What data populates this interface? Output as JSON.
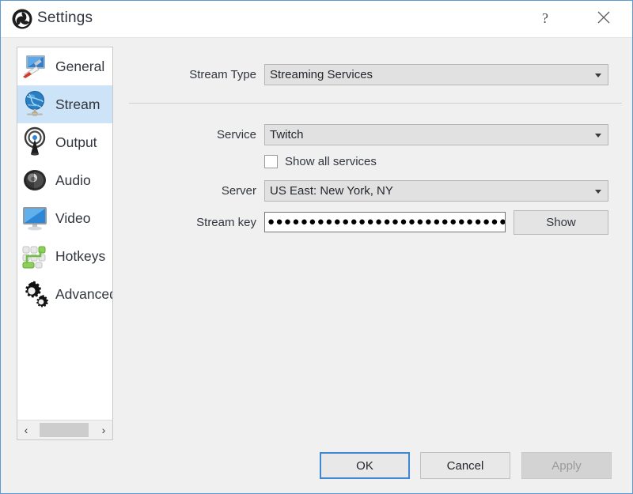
{
  "window": {
    "title": "Settings",
    "logo_icon": "obs-logo-icon",
    "help_label": "?",
    "close_label": "✕",
    "accent_color": "#5b9bd5",
    "selection_color": "#cde3f7"
  },
  "sidebar": {
    "items": [
      {
        "label": "General",
        "icon": "general-monitor-screwdriver-icon",
        "selected": false
      },
      {
        "label": "Stream",
        "icon": "stream-globe-icon",
        "selected": true
      },
      {
        "label": "Output",
        "icon": "output-broadcast-icon",
        "selected": false
      },
      {
        "label": "Audio",
        "icon": "audio-speaker-icon",
        "selected": false
      },
      {
        "label": "Video",
        "icon": "video-monitor-icon",
        "selected": false
      },
      {
        "label": "Hotkeys",
        "icon": "hotkeys-keyboard-icon",
        "selected": false
      },
      {
        "label": "Advanced",
        "icon": "advanced-gears-icon",
        "selected": false
      }
    ],
    "scrollbar": {
      "left_arrow": "‹",
      "right_arrow": "›"
    }
  },
  "main": {
    "stream_type": {
      "label": "Stream Type",
      "value": "Streaming Services"
    },
    "service": {
      "label": "Service",
      "value": "Twitch"
    },
    "show_all_services": {
      "label": "Show all services",
      "checked": false
    },
    "server": {
      "label": "Server",
      "value": "US East: New York, NY"
    },
    "stream_key": {
      "label": "Stream key",
      "value": "●●●●●●●●●●●●●●●●●●●●●●●●●●●●●●",
      "show_button_label": "Show"
    }
  },
  "footer": {
    "ok_label": "OK",
    "cancel_label": "Cancel",
    "apply_label": "Apply",
    "apply_enabled": false
  }
}
